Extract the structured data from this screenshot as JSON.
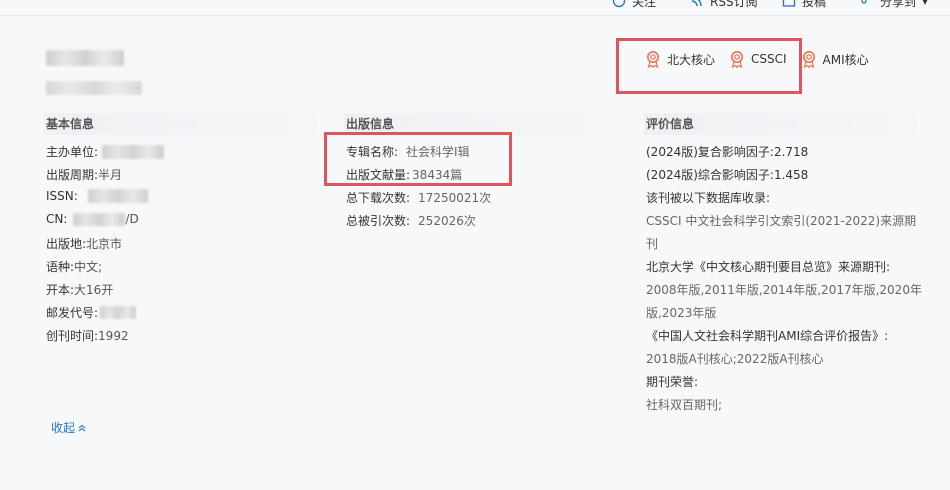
{
  "toolbar": {
    "follow": "关注",
    "rss": "RSS订阅",
    "submit": "投稿",
    "share": "分享到"
  },
  "badges": [
    "北大核心",
    "CSSCI",
    "AMI核心"
  ],
  "basic": {
    "heading": "基本信息",
    "sponsor_label": "主办单位:",
    "period_label": "出版周期:",
    "period_value": "半月",
    "issn_label": "ISSN:",
    "cn_label": "CN:",
    "cn_suffix": "/D",
    "place_label": "出版地:",
    "place_value": "北京市",
    "language_label": "语种:",
    "language_value": "中文;",
    "format_label": "开本:",
    "format_value": "大16开",
    "postal_label": "邮发代号:",
    "founded_label": "创刊时间:",
    "founded_value": "1992"
  },
  "publication": {
    "heading": "出版信息",
    "series_label": "专辑名称:",
    "series_value": "社会科学Ⅰ辑",
    "count_label": "出版文献量:",
    "count_value": "38434篇",
    "downloads_label": "总下载次数:",
    "downloads_value": "17250021次",
    "citations_label": "总被引次数:",
    "citations_value": "252026次"
  },
  "evaluation": {
    "heading": "评价信息",
    "lines": [
      "(2024版)复合影响因子:2.718",
      "(2024版)综合影响因子:1.458",
      "该刊被以下数据库收录:",
      "CSSCI 中文社会科学引文索引(2021-2022)来源期",
      "刊",
      "北京大学《中文核心期刊要目总览》来源期刊:",
      "2008年版,2011年版,2014年版,2017年版,2020年",
      "版,2023年版",
      "《中国人文社会科学期刊AMI综合评价报告》:",
      "2018版A刊核心;2022版A刊核心",
      "期刊荣誉:",
      "社科双百期刊;"
    ]
  },
  "collapse_label": "收起",
  "colors": {
    "highlight": "#e0555b",
    "badge_icon": "#e8734f",
    "link": "#1f74c6"
  }
}
